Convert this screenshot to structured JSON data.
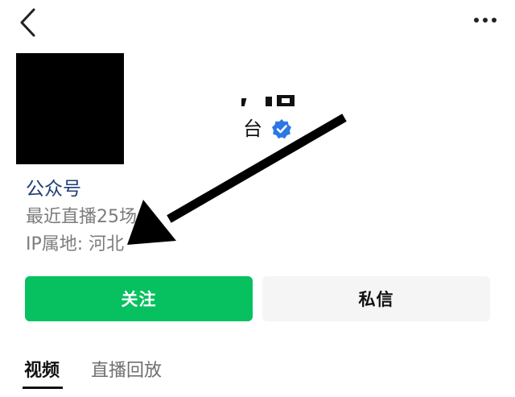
{
  "header": {
    "back_icon": "chevron-left-icon",
    "more_icon": "more-dots-icon"
  },
  "profile": {
    "name_fragment": "'、'",
    "name_visible": "台",
    "verified_icon": "verified-badge-icon",
    "type_label": "公众号",
    "recent_live": "最近直播25场",
    "ip_location": "IP属地: 河北"
  },
  "actions": {
    "follow_label": "关注",
    "message_label": "私信"
  },
  "tabs": [
    {
      "label": "视频",
      "active": true
    },
    {
      "label": "直播回放",
      "active": false
    }
  ],
  "colors": {
    "follow_green": "#07c160",
    "link_blue": "#1f3d73",
    "verified_blue": "#2b78e4"
  }
}
